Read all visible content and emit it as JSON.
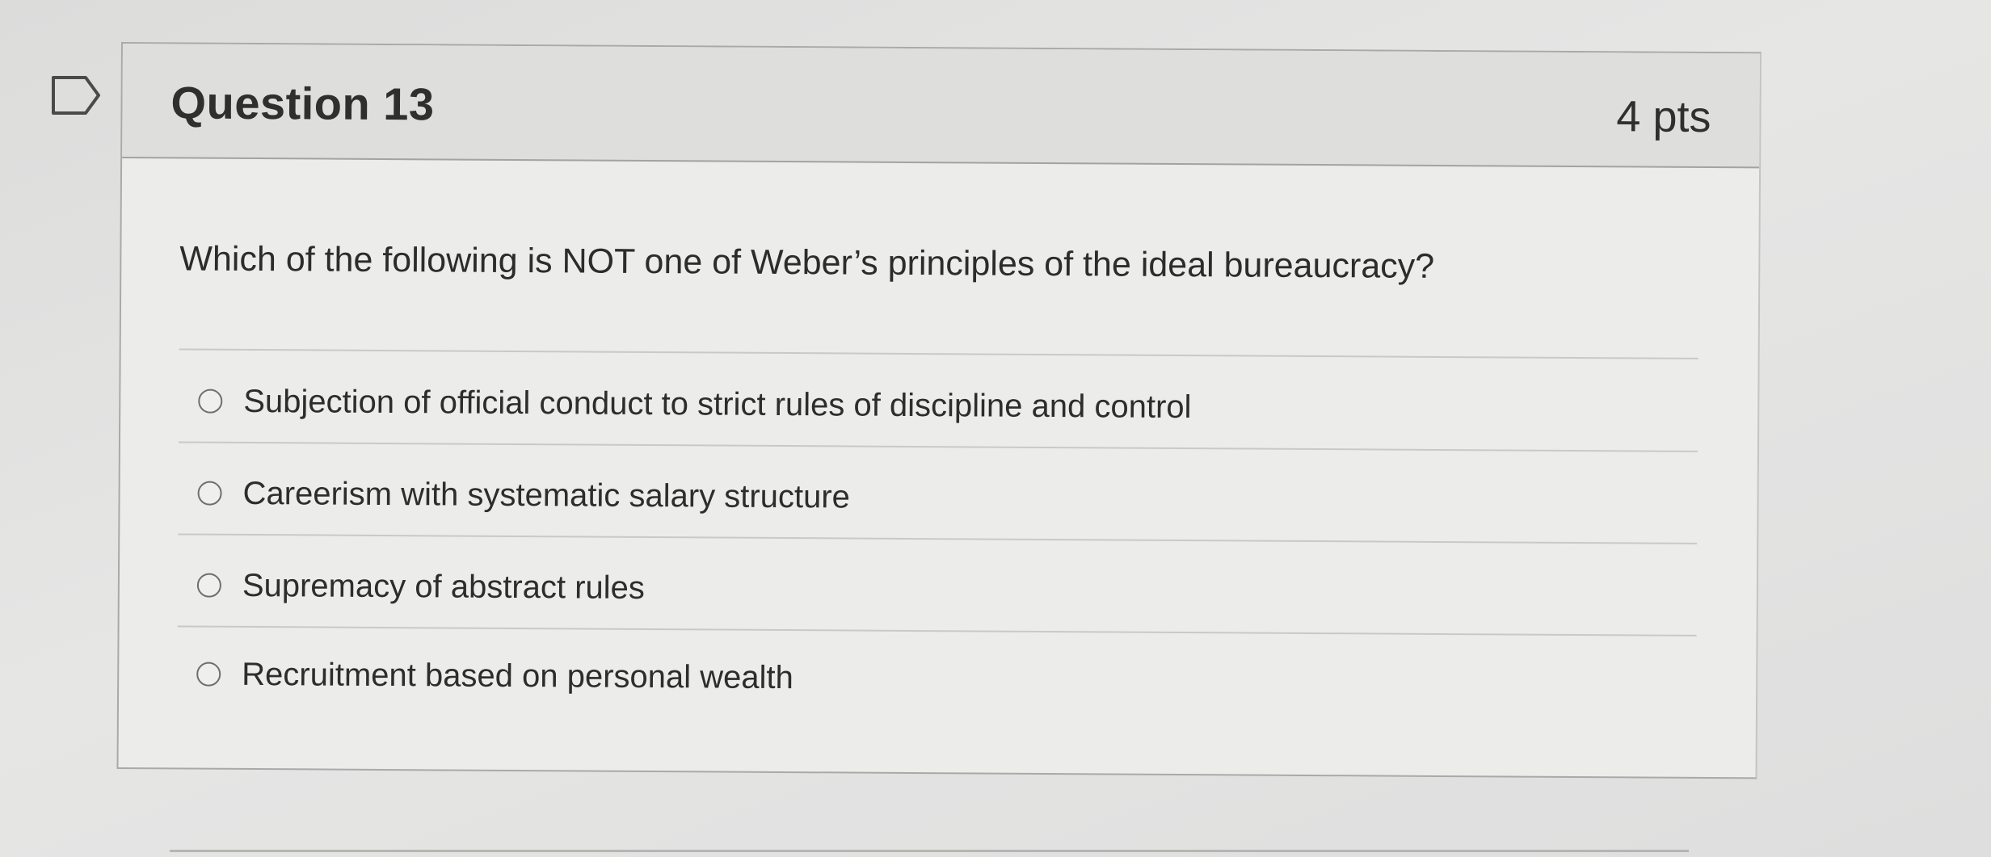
{
  "question": {
    "title": "Question 13",
    "points": "4 pts",
    "text": "Which of the following is NOT one of Weber’s principles of the ideal bureaucracy?",
    "answers": [
      {
        "label": "Subjection of official conduct to strict rules of discipline and control",
        "selected": false
      },
      {
        "label": "Careerism with systematic salary structure",
        "selected": false
      },
      {
        "label": "Supremacy of abstract rules",
        "selected": false
      },
      {
        "label": "Recruitment based on personal wealth",
        "selected": false
      }
    ]
  },
  "icons": {
    "flag": "flag-question-icon",
    "radio": "radio-button-icon"
  },
  "colors": {
    "background": "#e2e2e1",
    "card": "#ececeb",
    "header": "#dededd",
    "text": "#2f2f2f",
    "border": "#a9a9a7"
  }
}
